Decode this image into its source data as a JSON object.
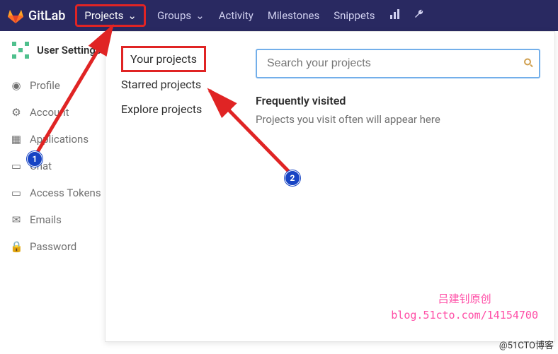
{
  "brand": "GitLab",
  "nav": {
    "projects": "Projects",
    "groups": "Groups",
    "activity": "Activity",
    "milestones": "Milestones",
    "snippets": "Snippets"
  },
  "sidebar": {
    "title": "User Settings",
    "items": [
      {
        "label": "Profile"
      },
      {
        "label": "Account"
      },
      {
        "label": "Applications"
      },
      {
        "label": "Chat"
      },
      {
        "label": "Access Tokens"
      },
      {
        "label": "Emails"
      },
      {
        "label": "Password"
      }
    ]
  },
  "dropdown": {
    "items": [
      "Your projects",
      "Starred projects",
      "Explore projects"
    ],
    "search_placeholder": "Search your projects",
    "freq_title": "Frequently visited",
    "freq_text": "Projects you visit often will appear here"
  },
  "badges": {
    "one": "1",
    "two": "2"
  },
  "watermark": {
    "line1": "吕建钊原创",
    "line2": "blog.51cto.com/14154700"
  },
  "credit": "@51CTO博客"
}
